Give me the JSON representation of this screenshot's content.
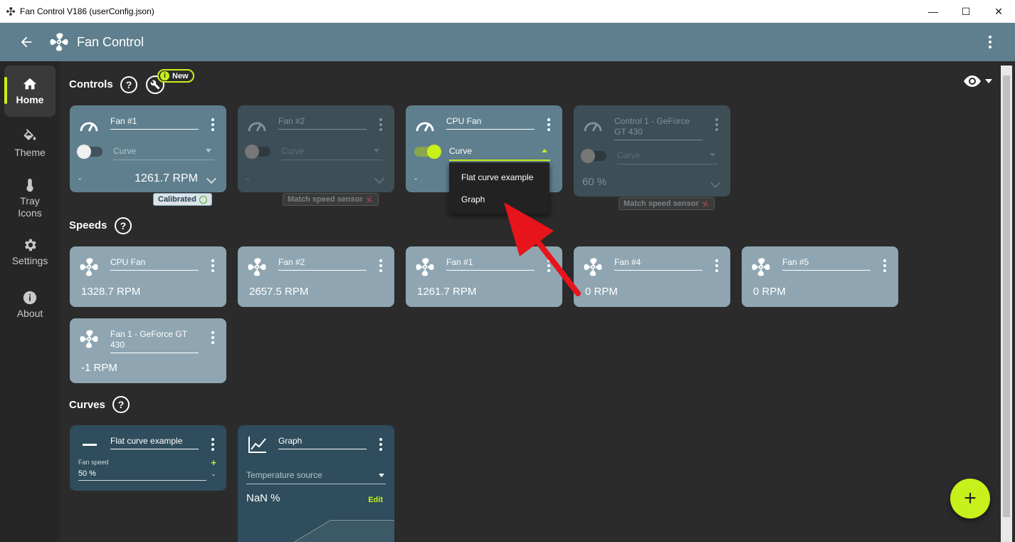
{
  "window": {
    "title": "Fan Control V186 (userConfig.json)",
    "min": "—",
    "max": "☐",
    "close": "✕"
  },
  "appbar": {
    "title": "Fan Control"
  },
  "sidebar": {
    "items": [
      {
        "label": "Home"
      },
      {
        "label": "Theme"
      },
      {
        "label": "Tray Icons"
      },
      {
        "label": "Settings"
      },
      {
        "label": "About"
      }
    ]
  },
  "sections": {
    "controls": "Controls",
    "speeds": "Speeds",
    "curves": "Curves",
    "help": "?",
    "new_badge": "New"
  },
  "controls": [
    {
      "name": "Fan #1",
      "mode": "Curve",
      "left": "-",
      "value": "1261.7 RPM",
      "enabled": false,
      "badge": "Calibrated"
    },
    {
      "name": "Fan #2",
      "mode": "Curve",
      "left": "-",
      "value": "",
      "enabled": false,
      "badge": "Match speed sensor"
    },
    {
      "name": "CPU Fan",
      "mode": "Curve",
      "left": "-",
      "value": "",
      "enabled": true,
      "badge": ""
    },
    {
      "name": "Control 1 - GeForce GT 430",
      "mode": "Curve",
      "left": "60 %",
      "value": "",
      "enabled": false,
      "badge": "Match speed sensor"
    }
  ],
  "dropdown": {
    "items": [
      "Flat curve example",
      "Graph"
    ]
  },
  "speeds": [
    {
      "name": "CPU Fan",
      "rpm": "1328.7 RPM"
    },
    {
      "name": "Fan #2",
      "rpm": "2657.5 RPM"
    },
    {
      "name": "Fan #1",
      "rpm": "1261.7 RPM"
    },
    {
      "name": "Fan #4",
      "rpm": "0 RPM"
    },
    {
      "name": "Fan #5",
      "rpm": "0 RPM"
    },
    {
      "name": "Fan 1 - GeForce GT 430",
      "rpm": "-1 RPM"
    }
  ],
  "curves": [
    {
      "name": "Flat curve example",
      "field_label": "Fan speed",
      "field_value": "50 %",
      "plus": "+",
      "minus": "-"
    },
    {
      "name": "Graph",
      "source_label": "Temperature source",
      "value": "NaN %",
      "edit": "Edit"
    }
  ],
  "fab": {
    "label": "+"
  },
  "colors": {
    "accent": "#c8f01a",
    "appbar": "#5f7f8e",
    "card_control": "#5f7f8e",
    "card_speed": "#8fa6b2",
    "card_curve": "#2f4d5c",
    "annotation_arrow": "#e8141c"
  }
}
